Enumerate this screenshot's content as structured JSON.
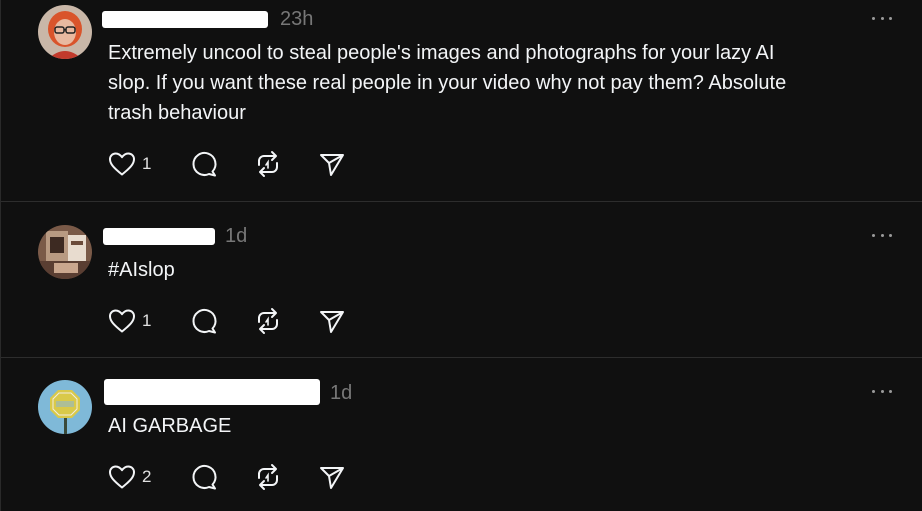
{
  "posts": [
    {
      "timestamp": "23h",
      "text": "Extremely uncool to steal people's images and photographs for your lazy AI\nslop. If you want these real people in your video why not pay them? Absolute\ntrash behaviour",
      "like_count": "1",
      "avatar_colors": {
        "bg": "#c9b7a8",
        "hair": "#d9542b",
        "skin": "#e8b9a0",
        "shirt": "#c23a2c"
      }
    },
    {
      "timestamp": "1d",
      "text": "#AIslop",
      "like_count": "1",
      "avatar_colors": {
        "bg": "#7a5a48",
        "accent": "#e8dccf",
        "shade": "#3d2a22"
      }
    },
    {
      "timestamp": "1d",
      "text": "AI GARBAGE",
      "like_count": "2",
      "avatar_colors": {
        "bg": "#7fb9d8",
        "sign": "#d9c94a",
        "pole": "#3a4a3a"
      }
    }
  ],
  "icons": {
    "like": "heart-icon",
    "reply": "comment-icon",
    "repost": "repost-icon",
    "share": "send-icon",
    "more": "more-options-icon"
  },
  "colors": {
    "background": "#101010",
    "text": "#f3f5f7",
    "muted": "#777777",
    "divider": "#2d2d2d"
  }
}
